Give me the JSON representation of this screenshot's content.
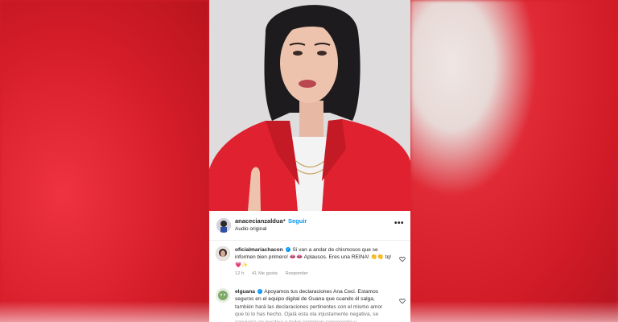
{
  "post": {
    "owner": {
      "username": "anacecianzaldua",
      "separator": "•",
      "follow_label": "Seguir",
      "audio_label": "Audio original"
    },
    "more_label": "•••"
  },
  "comments": [
    {
      "username": "oficialmariachacon",
      "verified": true,
      "text": "Si van a andar de chismosos que se informen bien primero! 👄👄 Aplausos. Eres una REINA! 👏👏 tq!💗✨",
      "time": "12 h",
      "likes": "41 Me gusta",
      "reply_label": "Responder"
    },
    {
      "username": "elguana",
      "verified": true,
      "text": "Apoyamos tus declaraciones Ana Ceci. Estamos seguros en el equipo digital de Guana que cuando él salga, también hará las declaraciones pertinentes con el mismo amor que tú lo has hecho. Ojalá esta ola injustamente negativa, se convierta en positiva y todos terminen conociendo y"
    }
  ],
  "colors": {
    "background_red": "#d41e2a",
    "link_blue": "#0095f6",
    "text_dark": "#262626",
    "text_muted": "#8e8e8e",
    "jacket_red": "#e0212f"
  }
}
